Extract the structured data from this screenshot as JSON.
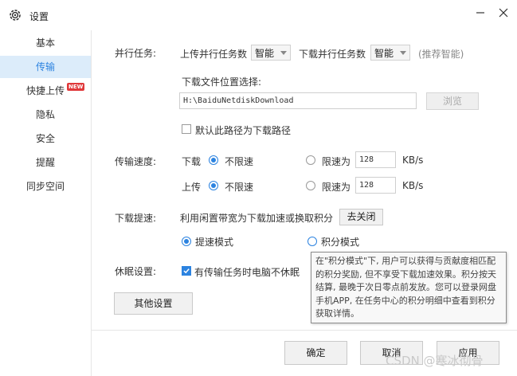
{
  "window": {
    "title": "设置"
  },
  "sidebar": {
    "items": [
      {
        "label": "基本",
        "active": false
      },
      {
        "label": "传输",
        "active": true
      },
      {
        "label": "快捷上传",
        "active": false,
        "badge": "NEW"
      },
      {
        "label": "隐私",
        "active": false
      },
      {
        "label": "安全",
        "active": false
      },
      {
        "label": "提醒",
        "active": false
      },
      {
        "label": "同步空间",
        "active": false
      }
    ]
  },
  "parallel": {
    "section_label": "并行任务:",
    "upload_label": "上传并行任务数",
    "upload_value": "智能",
    "download_label": "下载并行任务数",
    "download_value": "智能",
    "hint": "(推荐智能)"
  },
  "download_location": {
    "label": "下载文件位置选择:",
    "path": "H:\\BaiduNetdiskDownload",
    "browse": "浏览",
    "default_checkbox_label": "默认此路径为下载路径",
    "default_checked": false
  },
  "speed": {
    "section_label": "传输速度:",
    "download_label": "下载",
    "upload_label": "上传",
    "unlimited": "不限速",
    "limit": "限速为",
    "download_limit_value": "128",
    "upload_limit_value": "128",
    "unit": "KB/s"
  },
  "boost": {
    "section_label": "下载提速:",
    "description": "利用闲置带宽为下载加速或换取积分",
    "close_button": "去关闭",
    "mode_speed": "提速模式",
    "mode_points": "积分模式"
  },
  "sleep": {
    "section_label": "休眠设置:",
    "checkbox_label": "有传输任务时电脑不休眠",
    "checked": true
  },
  "tooltip": {
    "text": "在\"积分模式\"下, 用户可以获得与贡献度相匹配的积分奖励, 但不享受下载加速效果。积分按天结算, 最晚于次日零点前发放。您可以登录网盘手机APP, 在任务中心的积分明细中查看到积分获取详情。"
  },
  "other_settings_button": "其他设置",
  "footer": {
    "ok": "确定",
    "cancel": "取消",
    "apply": "应用"
  },
  "watermark": "CSDN @寒冰彻骨",
  "colors": {
    "accent": "#2c83e0",
    "nav_active_bg": "#dcecfa",
    "badge": "#e0383a"
  }
}
